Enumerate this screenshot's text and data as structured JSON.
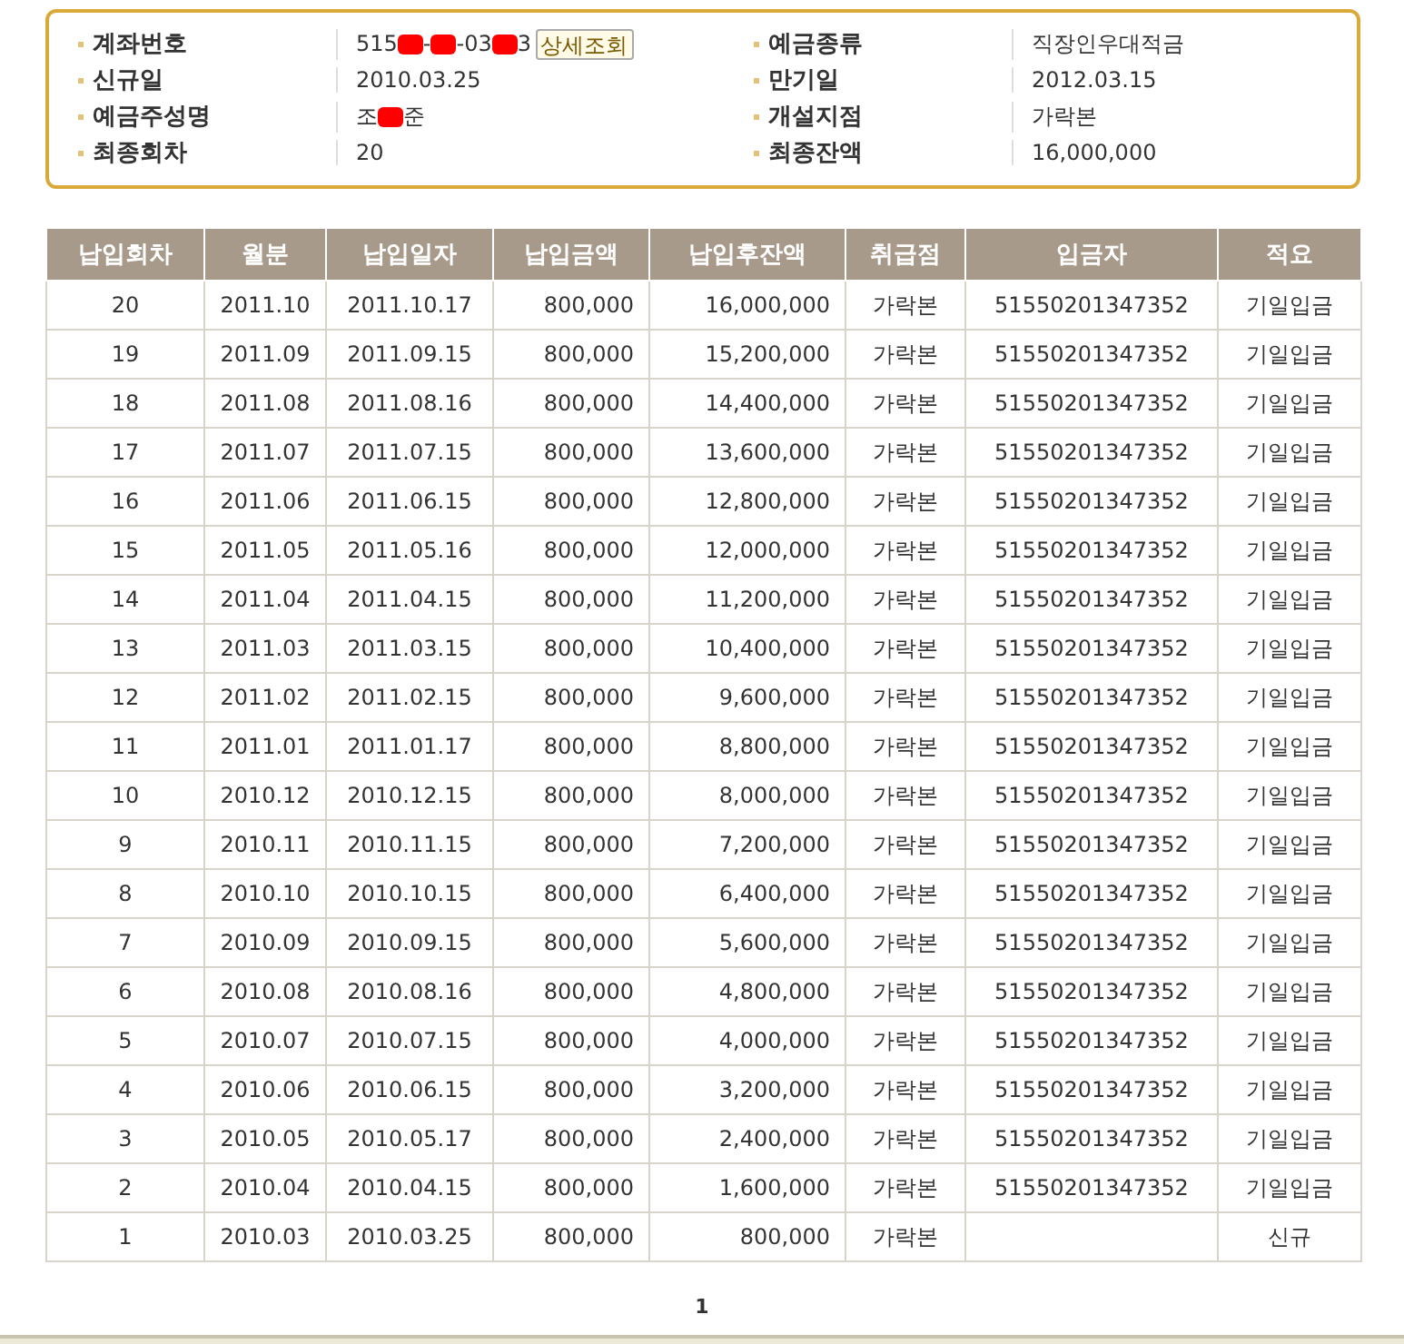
{
  "account_info": {
    "left": [
      {
        "label": "계좌번호",
        "parts": [
          "515",
          "-",
          "-03",
          "3"
        ],
        "button": "상세조회"
      },
      {
        "label": "신규일",
        "value": "2010.03.25"
      },
      {
        "label": "예금주성명",
        "parts": [
          "조",
          "준"
        ]
      },
      {
        "label": "최종회차",
        "value": "20"
      }
    ],
    "right": [
      {
        "label": "예금종류",
        "value": "직장인우대적금"
      },
      {
        "label": "만기일",
        "value": "2012.03.15"
      },
      {
        "label": "개설지점",
        "value": "가락본"
      },
      {
        "label": "최종잔액",
        "value": "16,000,000"
      }
    ]
  },
  "table": {
    "columns": [
      "납입회차",
      "월분",
      "납입일자",
      "납입금액",
      "납입후잔액",
      "취급점",
      "입금자",
      "적요"
    ],
    "rows": [
      [
        "20",
        "2011.10",
        "2011.10.17",
        "800,000",
        "16,000,000",
        "가락본",
        "51550201347352",
        "기일입금"
      ],
      [
        "19",
        "2011.09",
        "2011.09.15",
        "800,000",
        "15,200,000",
        "가락본",
        "51550201347352",
        "기일입금"
      ],
      [
        "18",
        "2011.08",
        "2011.08.16",
        "800,000",
        "14,400,000",
        "가락본",
        "51550201347352",
        "기일입금"
      ],
      [
        "17",
        "2011.07",
        "2011.07.15",
        "800,000",
        "13,600,000",
        "가락본",
        "51550201347352",
        "기일입금"
      ],
      [
        "16",
        "2011.06",
        "2011.06.15",
        "800,000",
        "12,800,000",
        "가락본",
        "51550201347352",
        "기일입금"
      ],
      [
        "15",
        "2011.05",
        "2011.05.16",
        "800,000",
        "12,000,000",
        "가락본",
        "51550201347352",
        "기일입금"
      ],
      [
        "14",
        "2011.04",
        "2011.04.15",
        "800,000",
        "11,200,000",
        "가락본",
        "51550201347352",
        "기일입금"
      ],
      [
        "13",
        "2011.03",
        "2011.03.15",
        "800,000",
        "10,400,000",
        "가락본",
        "51550201347352",
        "기일입금"
      ],
      [
        "12",
        "2011.02",
        "2011.02.15",
        "800,000",
        "9,600,000",
        "가락본",
        "51550201347352",
        "기일입금"
      ],
      [
        "11",
        "2011.01",
        "2011.01.17",
        "800,000",
        "8,800,000",
        "가락본",
        "51550201347352",
        "기일입금"
      ],
      [
        "10",
        "2010.12",
        "2010.12.15",
        "800,000",
        "8,000,000",
        "가락본",
        "51550201347352",
        "기일입금"
      ],
      [
        "9",
        "2010.11",
        "2010.11.15",
        "800,000",
        "7,200,000",
        "가락본",
        "51550201347352",
        "기일입금"
      ],
      [
        "8",
        "2010.10",
        "2010.10.15",
        "800,000",
        "6,400,000",
        "가락본",
        "51550201347352",
        "기일입금"
      ],
      [
        "7",
        "2010.09",
        "2010.09.15",
        "800,000",
        "5,600,000",
        "가락본",
        "51550201347352",
        "기일입금"
      ],
      [
        "6",
        "2010.08",
        "2010.08.16",
        "800,000",
        "4,800,000",
        "가락본",
        "51550201347352",
        "기일입금"
      ],
      [
        "5",
        "2010.07",
        "2010.07.15",
        "800,000",
        "4,000,000",
        "가락본",
        "51550201347352",
        "기일입금"
      ],
      [
        "4",
        "2010.06",
        "2010.06.15",
        "800,000",
        "3,200,000",
        "가락본",
        "51550201347352",
        "기일입금"
      ],
      [
        "3",
        "2010.05",
        "2010.05.17",
        "800,000",
        "2,400,000",
        "가락본",
        "51550201347352",
        "기일입금"
      ],
      [
        "2",
        "2010.04",
        "2010.04.15",
        "800,000",
        "1,600,000",
        "가락본",
        "51550201347352",
        "기일입금"
      ],
      [
        "1",
        "2010.03",
        "2010.03.25",
        "800,000",
        "800,000",
        "가락본",
        "",
        "신규"
      ]
    ]
  },
  "pagination": {
    "pages": [
      {
        "label": "1",
        "selected": true
      }
    ]
  }
}
